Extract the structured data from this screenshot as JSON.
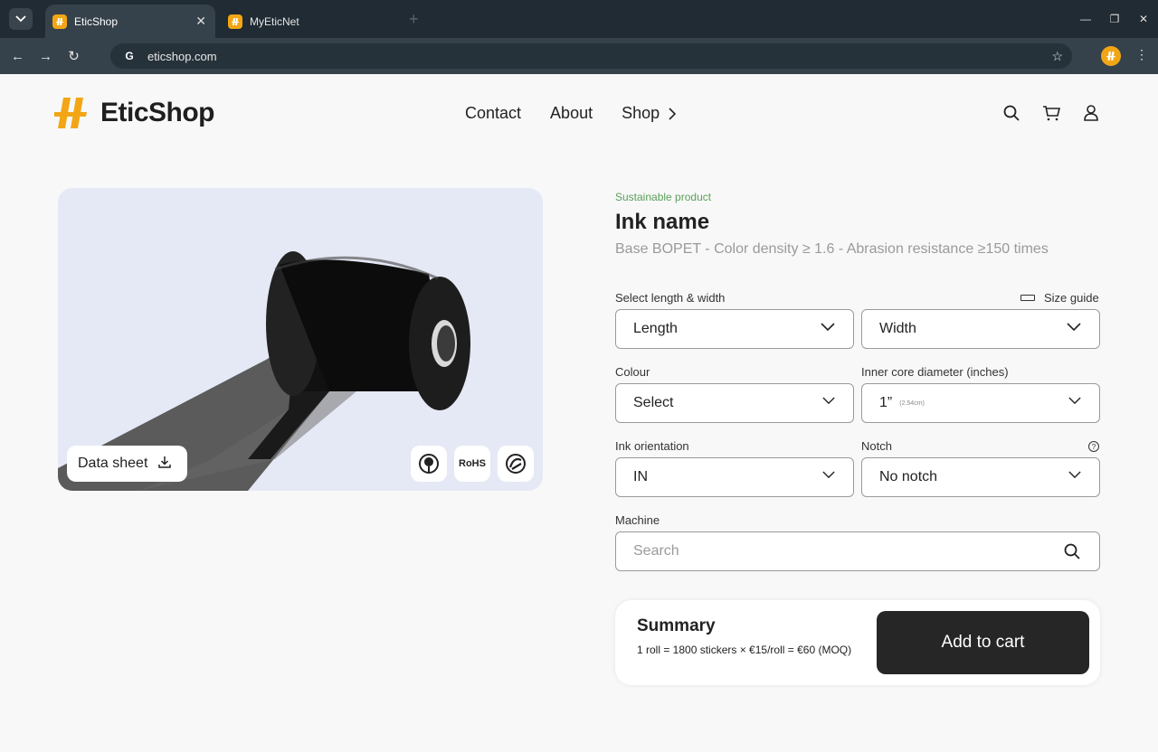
{
  "browser": {
    "tabs": [
      {
        "title": "EticShop",
        "active": true
      },
      {
        "title": "MyEticNet",
        "active": false
      }
    ],
    "url": "eticshop.com"
  },
  "header": {
    "brand": "EticShop",
    "nav": {
      "contact": "Contact",
      "about": "About",
      "shop": "Shop"
    }
  },
  "product": {
    "tag": "Sustainable product",
    "name": "Ink name",
    "description": "Base BOPET - Color density ≥ 1.6 - Abrasion resistance ≥150 times",
    "data_sheet": "Data sheet",
    "badges": {
      "rohs": "RoHS"
    }
  },
  "form": {
    "length_width_label": "Select length & width",
    "size_guide": "Size guide",
    "length": "Length",
    "width": "Width",
    "colour_label": "Colour",
    "colour_value": "Select",
    "core_label": "Inner core diameter (inches)",
    "core_value": "1”",
    "core_value_cm": "(2.54cm)",
    "orientation_label": "Ink orientation",
    "orientation_value": "IN",
    "notch_label": "Notch",
    "notch_value": "No notch",
    "machine_label": "Machine",
    "machine_placeholder": "Search"
  },
  "summary": {
    "title": "Summary",
    "text": "1 roll = 1800 stickers × €15/roll = €60 (MOQ)",
    "button": "Add to cart"
  },
  "colors": {
    "brand": "#f2a615",
    "accent_green": "#5aa05a",
    "button": "#262626"
  }
}
